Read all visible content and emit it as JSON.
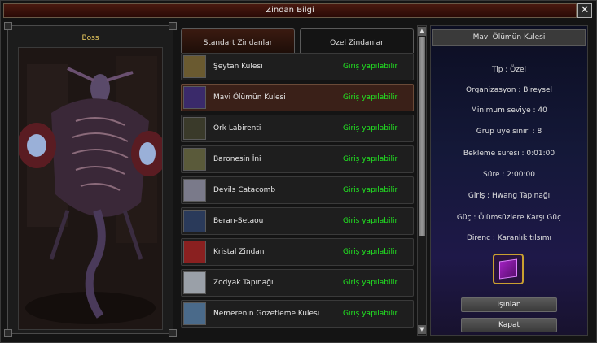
{
  "window": {
    "title": "Zindan Bilgi",
    "close_label": "✕"
  },
  "boss_panel": {
    "label": "Boss"
  },
  "tabs": [
    {
      "label": "Standart Zindanlar",
      "active": true
    },
    {
      "label": "Ozel Zindanlar",
      "active": false
    }
  ],
  "dungeons": [
    {
      "name": "Şeytan Kulesi",
      "status": "Giriş yapılabilir",
      "thumb_color": "#6a5a30"
    },
    {
      "name": "Mavi Ölümün Kulesi",
      "status": "Giriş yapılabilir",
      "thumb_color": "#3a2a6a",
      "selected": true
    },
    {
      "name": "Ork Labirenti",
      "status": "Giriş yapılabilir",
      "thumb_color": "#3a3a2a"
    },
    {
      "name": "Baronesin İni",
      "status": "Giriş yapılabilir",
      "thumb_color": "#5a5a3a"
    },
    {
      "name": "Devils Catacomb",
      "status": "Giriş yapılabilir",
      "thumb_color": "#7a7a8a"
    },
    {
      "name": "Beran-Setaou",
      "status": "Giriş yapılabilir",
      "thumb_color": "#2a3a5a"
    },
    {
      "name": "Kristal Zindan",
      "status": "Giriş yapılabilir",
      "thumb_color": "#8a2020"
    },
    {
      "name": "Zodyak Tapınağı",
      "status": "Giriş yapılabilir",
      "thumb_color": "#9aa0a8"
    },
    {
      "name": "Nemerenin Gözetleme Kulesi",
      "status": "Giriş yapılabilir",
      "thumb_color": "#4a6a8a"
    }
  ],
  "info": {
    "title": "Mavi Ölümün Kulesi",
    "lines": [
      "Tip : Özel",
      "Organizasyon : Bireysel",
      "Minimum seviye : 40",
      "Grup üye sınırı : 8",
      "Bekleme süresi : 0:01:00",
      "Süre : 2:00:00",
      "Giriş : Hwang Tapınağı",
      "Güç : Ölümsüzlere Karşı Güç",
      "Direnç : Karanlık tılsımı"
    ],
    "item_icon": "purple-book-icon",
    "teleport_label": "Işınlan",
    "close_label": "Kapat"
  },
  "colors": {
    "status_green": "#22e822",
    "boss_label": "#f0d060"
  }
}
